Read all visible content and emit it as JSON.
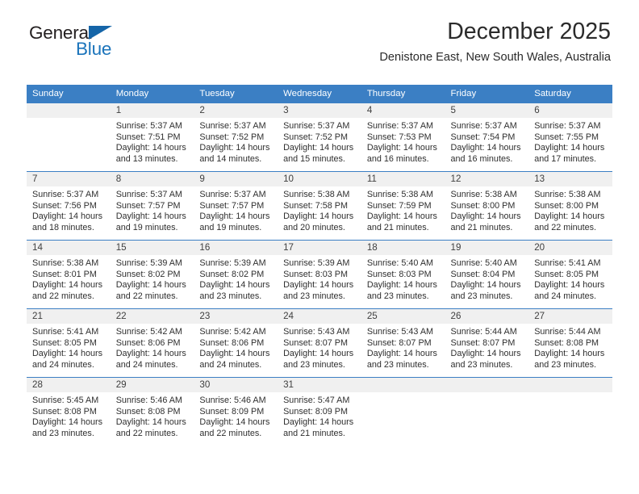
{
  "brand": {
    "name_part1": "General",
    "name_part2": "Blue",
    "color_dark": "#231f20",
    "color_blue": "#1b74bb"
  },
  "header": {
    "title": "December 2025",
    "subtitle": "Denistone East, New South Wales, Australia"
  },
  "theme": {
    "header_row_bg": "#3b7fc4",
    "daynum_band_bg": "#f0f0f0",
    "row_border": "#3b7fc4"
  },
  "calendar": {
    "weekday_headers": [
      "Sunday",
      "Monday",
      "Tuesday",
      "Wednesday",
      "Thursday",
      "Friday",
      "Saturday"
    ],
    "weeks": [
      [
        {
          "day": "",
          "empty": true,
          "sunrise": "",
          "sunset": "",
          "daylight_line1": "",
          "daylight_line2": ""
        },
        {
          "day": "1",
          "sunrise": "Sunrise: 5:37 AM",
          "sunset": "Sunset: 7:51 PM",
          "daylight_line1": "Daylight: 14 hours",
          "daylight_line2": "and 13 minutes."
        },
        {
          "day": "2",
          "sunrise": "Sunrise: 5:37 AM",
          "sunset": "Sunset: 7:52 PM",
          "daylight_line1": "Daylight: 14 hours",
          "daylight_line2": "and 14 minutes."
        },
        {
          "day": "3",
          "sunrise": "Sunrise: 5:37 AM",
          "sunset": "Sunset: 7:52 PM",
          "daylight_line1": "Daylight: 14 hours",
          "daylight_line2": "and 15 minutes."
        },
        {
          "day": "4",
          "sunrise": "Sunrise: 5:37 AM",
          "sunset": "Sunset: 7:53 PM",
          "daylight_line1": "Daylight: 14 hours",
          "daylight_line2": "and 16 minutes."
        },
        {
          "day": "5",
          "sunrise": "Sunrise: 5:37 AM",
          "sunset": "Sunset: 7:54 PM",
          "daylight_line1": "Daylight: 14 hours",
          "daylight_line2": "and 16 minutes."
        },
        {
          "day": "6",
          "sunrise": "Sunrise: 5:37 AM",
          "sunset": "Sunset: 7:55 PM",
          "daylight_line1": "Daylight: 14 hours",
          "daylight_line2": "and 17 minutes."
        }
      ],
      [
        {
          "day": "7",
          "sunrise": "Sunrise: 5:37 AM",
          "sunset": "Sunset: 7:56 PM",
          "daylight_line1": "Daylight: 14 hours",
          "daylight_line2": "and 18 minutes."
        },
        {
          "day": "8",
          "sunrise": "Sunrise: 5:37 AM",
          "sunset": "Sunset: 7:57 PM",
          "daylight_line1": "Daylight: 14 hours",
          "daylight_line2": "and 19 minutes."
        },
        {
          "day": "9",
          "sunrise": "Sunrise: 5:37 AM",
          "sunset": "Sunset: 7:57 PM",
          "daylight_line1": "Daylight: 14 hours",
          "daylight_line2": "and 19 minutes."
        },
        {
          "day": "10",
          "sunrise": "Sunrise: 5:38 AM",
          "sunset": "Sunset: 7:58 PM",
          "daylight_line1": "Daylight: 14 hours",
          "daylight_line2": "and 20 minutes."
        },
        {
          "day": "11",
          "sunrise": "Sunrise: 5:38 AM",
          "sunset": "Sunset: 7:59 PM",
          "daylight_line1": "Daylight: 14 hours",
          "daylight_line2": "and 21 minutes."
        },
        {
          "day": "12",
          "sunrise": "Sunrise: 5:38 AM",
          "sunset": "Sunset: 8:00 PM",
          "daylight_line1": "Daylight: 14 hours",
          "daylight_line2": "and 21 minutes."
        },
        {
          "day": "13",
          "sunrise": "Sunrise: 5:38 AM",
          "sunset": "Sunset: 8:00 PM",
          "daylight_line1": "Daylight: 14 hours",
          "daylight_line2": "and 22 minutes."
        }
      ],
      [
        {
          "day": "14",
          "sunrise": "Sunrise: 5:38 AM",
          "sunset": "Sunset: 8:01 PM",
          "daylight_line1": "Daylight: 14 hours",
          "daylight_line2": "and 22 minutes."
        },
        {
          "day": "15",
          "sunrise": "Sunrise: 5:39 AM",
          "sunset": "Sunset: 8:02 PM",
          "daylight_line1": "Daylight: 14 hours",
          "daylight_line2": "and 22 minutes."
        },
        {
          "day": "16",
          "sunrise": "Sunrise: 5:39 AM",
          "sunset": "Sunset: 8:02 PM",
          "daylight_line1": "Daylight: 14 hours",
          "daylight_line2": "and 23 minutes."
        },
        {
          "day": "17",
          "sunrise": "Sunrise: 5:39 AM",
          "sunset": "Sunset: 8:03 PM",
          "daylight_line1": "Daylight: 14 hours",
          "daylight_line2": "and 23 minutes."
        },
        {
          "day": "18",
          "sunrise": "Sunrise: 5:40 AM",
          "sunset": "Sunset: 8:03 PM",
          "daylight_line1": "Daylight: 14 hours",
          "daylight_line2": "and 23 minutes."
        },
        {
          "day": "19",
          "sunrise": "Sunrise: 5:40 AM",
          "sunset": "Sunset: 8:04 PM",
          "daylight_line1": "Daylight: 14 hours",
          "daylight_line2": "and 23 minutes."
        },
        {
          "day": "20",
          "sunrise": "Sunrise: 5:41 AM",
          "sunset": "Sunset: 8:05 PM",
          "daylight_line1": "Daylight: 14 hours",
          "daylight_line2": "and 24 minutes."
        }
      ],
      [
        {
          "day": "21",
          "sunrise": "Sunrise: 5:41 AM",
          "sunset": "Sunset: 8:05 PM",
          "daylight_line1": "Daylight: 14 hours",
          "daylight_line2": "and 24 minutes."
        },
        {
          "day": "22",
          "sunrise": "Sunrise: 5:42 AM",
          "sunset": "Sunset: 8:06 PM",
          "daylight_line1": "Daylight: 14 hours",
          "daylight_line2": "and 24 minutes."
        },
        {
          "day": "23",
          "sunrise": "Sunrise: 5:42 AM",
          "sunset": "Sunset: 8:06 PM",
          "daylight_line1": "Daylight: 14 hours",
          "daylight_line2": "and 24 minutes."
        },
        {
          "day": "24",
          "sunrise": "Sunrise: 5:43 AM",
          "sunset": "Sunset: 8:07 PM",
          "daylight_line1": "Daylight: 14 hours",
          "daylight_line2": "and 23 minutes."
        },
        {
          "day": "25",
          "sunrise": "Sunrise: 5:43 AM",
          "sunset": "Sunset: 8:07 PM",
          "daylight_line1": "Daylight: 14 hours",
          "daylight_line2": "and 23 minutes."
        },
        {
          "day": "26",
          "sunrise": "Sunrise: 5:44 AM",
          "sunset": "Sunset: 8:07 PM",
          "daylight_line1": "Daylight: 14 hours",
          "daylight_line2": "and 23 minutes."
        },
        {
          "day": "27",
          "sunrise": "Sunrise: 5:44 AM",
          "sunset": "Sunset: 8:08 PM",
          "daylight_line1": "Daylight: 14 hours",
          "daylight_line2": "and 23 minutes."
        }
      ],
      [
        {
          "day": "28",
          "sunrise": "Sunrise: 5:45 AM",
          "sunset": "Sunset: 8:08 PM",
          "daylight_line1": "Daylight: 14 hours",
          "daylight_line2": "and 23 minutes."
        },
        {
          "day": "29",
          "sunrise": "Sunrise: 5:46 AM",
          "sunset": "Sunset: 8:08 PM",
          "daylight_line1": "Daylight: 14 hours",
          "daylight_line2": "and 22 minutes."
        },
        {
          "day": "30",
          "sunrise": "Sunrise: 5:46 AM",
          "sunset": "Sunset: 8:09 PM",
          "daylight_line1": "Daylight: 14 hours",
          "daylight_line2": "and 22 minutes."
        },
        {
          "day": "31",
          "sunrise": "Sunrise: 5:47 AM",
          "sunset": "Sunset: 8:09 PM",
          "daylight_line1": "Daylight: 14 hours",
          "daylight_line2": "and 21 minutes."
        },
        {
          "day": "",
          "empty": true,
          "sunrise": "",
          "sunset": "",
          "daylight_line1": "",
          "daylight_line2": ""
        },
        {
          "day": "",
          "empty": true,
          "sunrise": "",
          "sunset": "",
          "daylight_line1": "",
          "daylight_line2": ""
        },
        {
          "day": "",
          "empty": true,
          "sunrise": "",
          "sunset": "",
          "daylight_line1": "",
          "daylight_line2": ""
        }
      ]
    ]
  }
}
